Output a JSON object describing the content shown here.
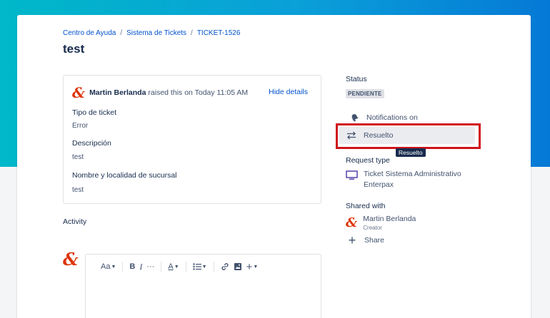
{
  "breadcrumb": {
    "items": [
      "Centro de Ayuda",
      "Sistema de Tickets",
      "TICKET-1526"
    ],
    "separator": "/"
  },
  "ticket": {
    "title": "test",
    "raised_by": "Martin Berlanda",
    "raised_text": "raised this on Today 11:05 AM",
    "hide_details": "Hide details",
    "fields": [
      {
        "label": "Tipo de ticket",
        "value": "Error"
      },
      {
        "label": "Descripción",
        "value": "test"
      },
      {
        "label": "Nombre y localidad de sucursal",
        "value": "test"
      }
    ]
  },
  "activity": {
    "label": "Activity",
    "toolbar": {
      "text_style": "Aa",
      "bold": "B",
      "italic": "I",
      "more": "···",
      "color": "A"
    }
  },
  "sidebar": {
    "status_label": "Status",
    "status_value": "PENDIENTE",
    "notifications": "Notifications on",
    "resolve_button": "Resuelto",
    "tooltip": "Resuelto",
    "request_type_label": "Request type",
    "request_type_value": "Ticket Sistema Administrativo Enterpax",
    "shared_with_label": "Shared with",
    "shared_name": "Martin Berlanda",
    "shared_role": "Creator",
    "share": "Share"
  },
  "icons": {
    "avatar": "ampersand-logo-icon",
    "notifications": "bell-icon",
    "transition": "swap-arrows-icon",
    "request_type": "monitor-icon",
    "share": "plus-icon"
  },
  "colors": {
    "accent_link": "#0052cc",
    "highlight_border": "#d0121b",
    "avatar_red": "#de350b",
    "banner_start": "#00b8c9",
    "banner_end": "#0579d6"
  }
}
